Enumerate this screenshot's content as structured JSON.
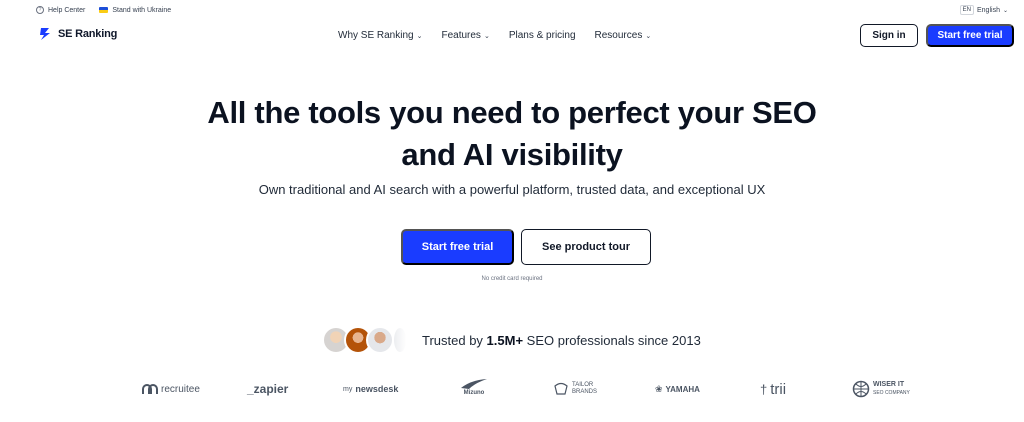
{
  "utility": {
    "help_center": "Help Center",
    "stand_with_ukraine": "Stand with Ukraine",
    "language_code": "EN",
    "language_label": "English"
  },
  "nav": {
    "brand": "SE Ranking",
    "links": [
      {
        "label": "Why SE Ranking",
        "dropdown": true
      },
      {
        "label": "Features",
        "dropdown": true
      },
      {
        "label": "Plans & pricing",
        "dropdown": false
      },
      {
        "label": "Resources",
        "dropdown": true
      }
    ],
    "sign_in": "Sign in",
    "start_trial": "Start free trial",
    "accent_color": "#1a3cff"
  },
  "hero": {
    "title_line1": "All the tools you need to perfect your SEO",
    "title_line2": "and AI visibility",
    "subtitle": "Own traditional and AI search with a powerful platform, trusted data, and exceptional UX",
    "cta_primary": "Start free trial",
    "cta_secondary": "See product tour",
    "note": "No credit card required"
  },
  "trusted": {
    "prefix": "Trusted by ",
    "count": "1.5M+",
    "suffix": " SEO professionals since 2013"
  },
  "brands": {
    "recruitee": "recruitee",
    "zapier": "_zapier",
    "newsdesk_prefix": "my",
    "newsdesk": "newsdesk",
    "mizuno": "Mizuno",
    "tailor_1": "TAILOR",
    "tailor_2": "BRANDS",
    "yamaha": "YAMAHA",
    "trii": "trii",
    "wiser_1": "WISER IT",
    "wiser_2": "SEO COMPANY"
  }
}
